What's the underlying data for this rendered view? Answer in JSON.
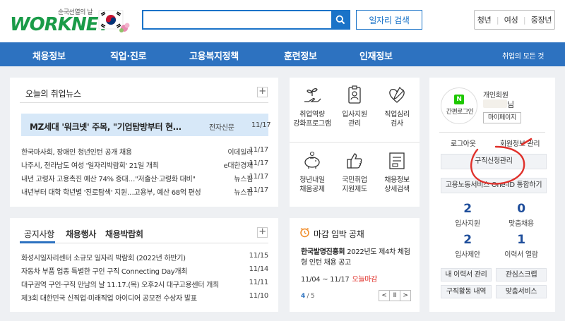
{
  "header": {
    "logo_sub": "순국선열의 날",
    "logo_text": "WORKNET",
    "search_placeholder": "",
    "job_search_label": "일자리 검색",
    "top_links": [
      "청년",
      "여성",
      "중장년"
    ]
  },
  "nav": {
    "items": [
      "채용정보",
      "직업·진로",
      "고용복지정책",
      "훈련정보",
      "인재정보"
    ],
    "all_label": "취업의 모든 것"
  },
  "news": {
    "title": "오늘의 취업뉴스",
    "headline": {
      "title": "MZ세대 '워크넷' 주목, \"기업탐방부터 현직자 멘토링까지\"",
      "source": "전자신문",
      "date": "11/17"
    },
    "items": [
      {
        "title": "한국마사회, 장애인 청년인턴 공개 채용",
        "source": "이데일리",
        "date": "11/17"
      },
      {
        "title": "나주시, 전라남도 여성 '일자리박람회' 21일 개최",
        "source": "e대한경제",
        "date": "11/17"
      },
      {
        "title": "내년 고령자 고용촉진 예산 74% 증대…\"저출산·고령화 대비\"",
        "source": "뉴스핌",
        "date": "11/17"
      },
      {
        "title": "내년부터 대학 학년별 '진로탐색' 지원…고용부, 예산 68억 편성",
        "source": "뉴스핌",
        "date": "11/17"
      }
    ]
  },
  "notice": {
    "tabs": [
      "공지사항",
      "채용행사",
      "채용박람회"
    ],
    "items": [
      {
        "title": "화성시일자리센터 소규모 일자리 박람회 (2022년 하반기)",
        "date": "11/15"
      },
      {
        "title": "자동차 부품 업종 특별한 구인 구직 Connecting Day개최",
        "date": "11/14"
      },
      {
        "title": "대구권역 구인·구직 만남의 날 11.17.(목) 오후2시 대구고용센터 개최",
        "date": "11/11"
      },
      {
        "title": "제3회 대한민국 신직업·미래직업 아이디어 공모전 수상자 발표",
        "date": "11/10"
      }
    ]
  },
  "services": [
    {
      "label1": "취업역량",
      "label2": "강화프로그램",
      "icon": "sprout-hand-icon"
    },
    {
      "label1": "입사지원",
      "label2": "관리",
      "icon": "id-badge-icon"
    },
    {
      "label1": "직업심리",
      "label2": "검사",
      "icon": "heart-check-icon"
    },
    {
      "label1": "청년내일",
      "label2": "채움공제",
      "icon": "piggy-bank-icon"
    },
    {
      "label1": "국민취업",
      "label2": "지원제도",
      "icon": "thumbs-up-icon"
    },
    {
      "label1": "채용정보",
      "label2": "상세검색",
      "icon": "document-list-icon"
    }
  ],
  "deadline": {
    "title": "마감 임박 공채",
    "company": "한국발명진흥회",
    "desc": " 2022년도 제4차 체험형 인턴 채용 공고",
    "dates": "11/04 ~ 11/17",
    "status": "오늘마감",
    "page_current": "4",
    "page_total": "/ 5",
    "controls": [
      "<",
      "II",
      ">"
    ]
  },
  "member": {
    "login_type": "간편로그인",
    "member_type": "개인회원",
    "name_suffix": "님",
    "mypage_label": "마이페이지",
    "logout_label": "로그아웃",
    "edit_label": "회원정보 관리",
    "job_manage_label": "구직신청관리",
    "one_id_label": "고용노동서비스 One-ID 통합하기",
    "stats": [
      {
        "num": "2",
        "label": "입사지원"
      },
      {
        "num": "0",
        "label": "맞춤채용"
      },
      {
        "num": "2",
        "label": "입사제안"
      },
      {
        "num": "1",
        "label": "이력서 열람"
      }
    ],
    "buttons": [
      "내 이력서 관리",
      "관심스크랩",
      "구직활동 내역",
      "맞춤서비스"
    ]
  },
  "colors": {
    "nav": "#2d72c0",
    "accent": "#1a73c8",
    "headline_bg": "#d7e8f8",
    "stat": "#1f4e9b",
    "annotation": "#e0312b"
  }
}
